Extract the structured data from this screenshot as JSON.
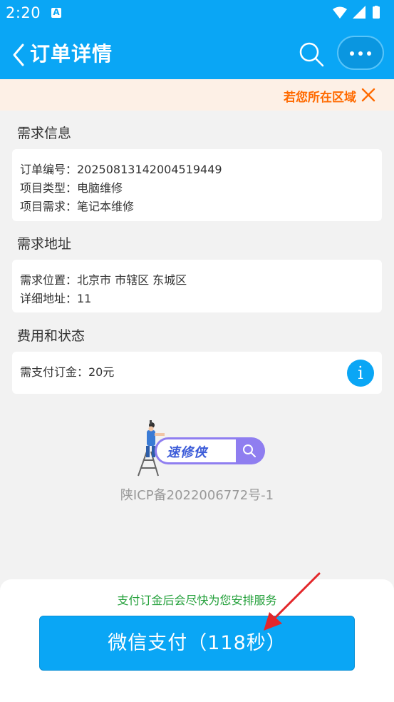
{
  "status_bar": {
    "time": "2:20",
    "notification_glyph": "A",
    "icons": [
      "wifi-icon",
      "signal-icon",
      "battery-icon"
    ]
  },
  "nav": {
    "title": "订单详情",
    "icons": [
      "back-chevron-icon",
      "search-icon",
      "more-dots-icon"
    ]
  },
  "notice": {
    "text": "若您所在区域"
  },
  "sections": {
    "demand_info": {
      "title": "需求信息",
      "lines": [
        "订单编号：20250813142004519449",
        "项目类型：电脑维修",
        "项目需求：笔记本维修"
      ]
    },
    "address": {
      "title": "需求地址",
      "lines": [
        "需求位置：北京市 市辖区 东城区",
        "详细地址：11"
      ]
    },
    "fee": {
      "title": "费用和状态",
      "lines": [
        "需支付订金：20元"
      ],
      "info_glyph": "i"
    }
  },
  "brand": {
    "logo_text": "速修侠",
    "icp": "陕ICP备2022006772号-1"
  },
  "payment": {
    "hint": "支付订金后会尽快为您安排服务",
    "button_label": "微信支付（118秒）"
  },
  "colors": {
    "primary": "#0aa6f5",
    "notice_text": "#ff6a00",
    "hint_green": "#23a03a",
    "arrow_red": "#e3262a"
  }
}
